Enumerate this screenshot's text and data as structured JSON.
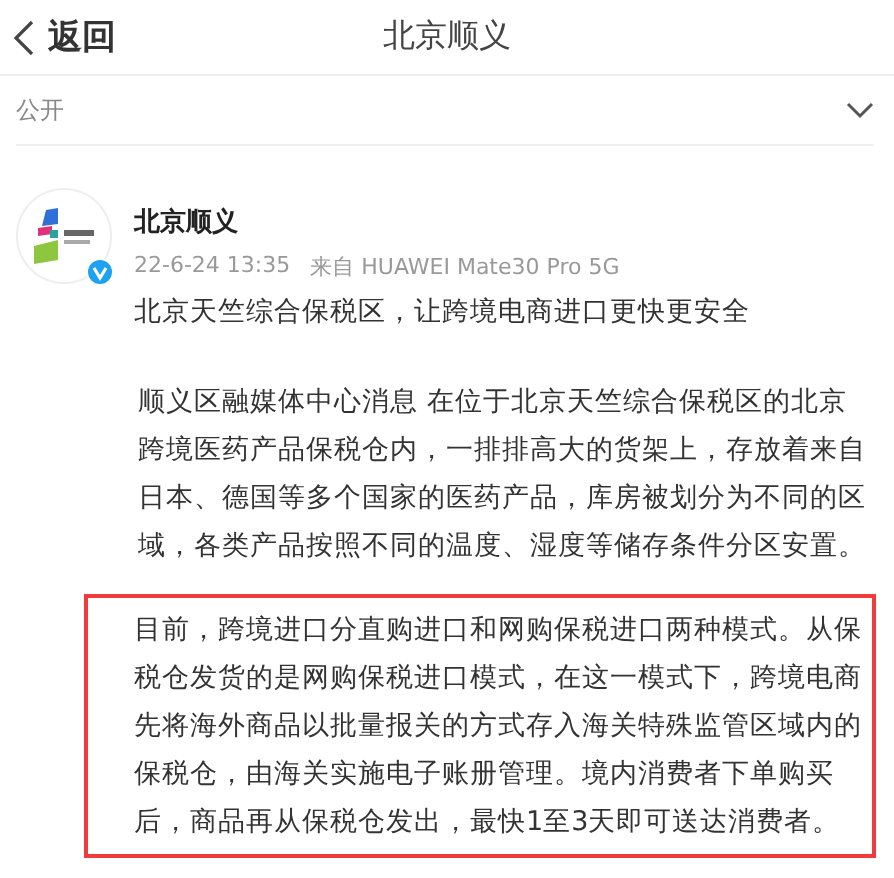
{
  "header": {
    "back_label": "返回",
    "title": "北京顺义"
  },
  "visibility": {
    "label": "公开"
  },
  "post": {
    "author": "北京顺义",
    "verified": true,
    "time": "22-6-24 13:35",
    "source": "来自 HUAWEI Mate30 Pro 5G",
    "headline": "北京天竺综合保税区，让跨境电商进口更快更安全",
    "paragraphs": [
      {
        "text": "顺义区融媒体中心消息  在位于北京天竺综合保税区的北京跨境医药产品保税仓内，一排排高大的货架上，存放着来自日本、德国等多个国家的医药产品，库房被划分为不同的区域，各类产品按照不同的温度、湿度等储存条件分区安置。",
        "highlighted": false
      },
      {
        "text": "目前，跨境进口分直购进口和网购保税进口两种模式。从保税仓发货的是网购保税进口模式，在这一模式下，跨境电商先将海外商品以批量报关的方式存入海关特殊监管区域内的保税仓，由海关实施电子账册管理。境内消费者下单购买后，商品再从保税仓发出，最快1至3天即可送达消费者。",
        "highlighted": true
      }
    ]
  }
}
